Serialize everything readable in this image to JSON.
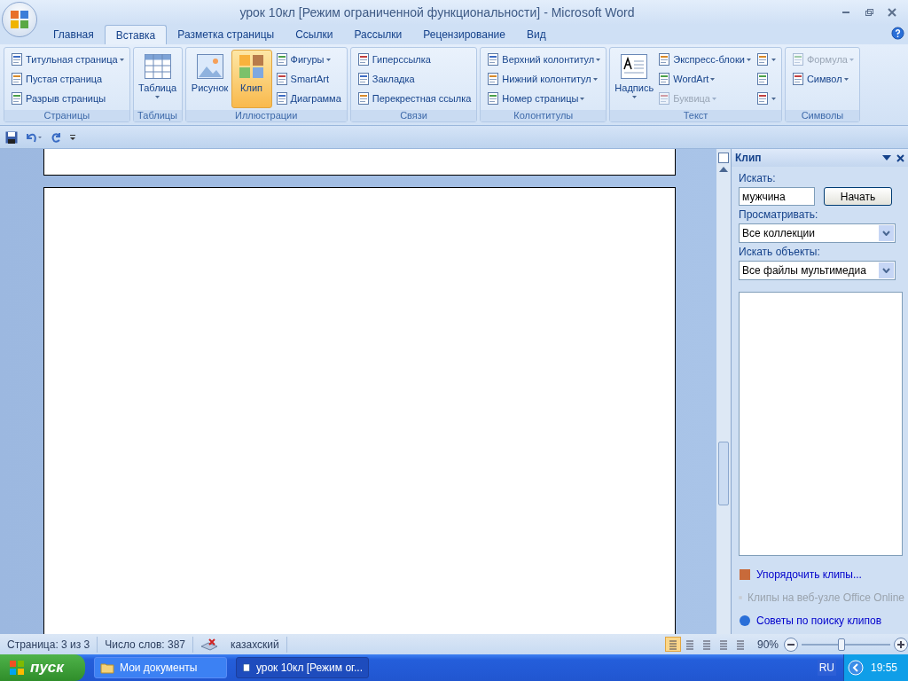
{
  "window": {
    "title": "урок 10кл [Режим ограниченной функциональности] - Microsoft Word"
  },
  "tabs": [
    {
      "label": "Главная",
      "selected": false
    },
    {
      "label": "Вставка",
      "selected": true
    },
    {
      "label": "Разметка страницы",
      "selected": false
    },
    {
      "label": "Ссылки",
      "selected": false
    },
    {
      "label": "Рассылки",
      "selected": false
    },
    {
      "label": "Рецензирование",
      "selected": false
    },
    {
      "label": "Вид",
      "selected": false
    }
  ],
  "ribbon": {
    "groups": [
      {
        "label": "Страницы",
        "columns": [
          [
            {
              "kind": "small",
              "label": "Титульная страница",
              "dropdown": true,
              "disabled": false
            },
            {
              "kind": "small",
              "label": "Пустая страница",
              "dropdown": false,
              "disabled": false
            },
            {
              "kind": "small",
              "label": "Разрыв страницы",
              "dropdown": false,
              "disabled": false
            }
          ]
        ]
      },
      {
        "label": "Таблицы",
        "columns": [
          [
            {
              "kind": "large",
              "label": "Таблица",
              "dropdown": true,
              "disabled": false,
              "selected": false
            }
          ]
        ]
      },
      {
        "label": "Иллюстрации",
        "columns": [
          [
            {
              "kind": "large",
              "label": "Рисунок",
              "dropdown": false,
              "disabled": false,
              "selected": false
            }
          ],
          [
            {
              "kind": "large",
              "label": "Клип",
              "dropdown": false,
              "disabled": false,
              "selected": true
            }
          ],
          [
            {
              "kind": "small",
              "label": "Фигуры",
              "dropdown": true,
              "disabled": false
            },
            {
              "kind": "small",
              "label": "SmartArt",
              "dropdown": false,
              "disabled": false
            },
            {
              "kind": "small",
              "label": "Диаграмма",
              "dropdown": false,
              "disabled": false
            }
          ]
        ]
      },
      {
        "label": "Связи",
        "columns": [
          [
            {
              "kind": "small",
              "label": "Гиперссылка",
              "dropdown": false,
              "disabled": false
            },
            {
              "kind": "small",
              "label": "Закладка",
              "dropdown": false,
              "disabled": false
            },
            {
              "kind": "small",
              "label": "Перекрестная ссылка",
              "dropdown": false,
              "disabled": false
            }
          ]
        ]
      },
      {
        "label": "Колонтитулы",
        "columns": [
          [
            {
              "kind": "small",
              "label": "Верхний колонтитул",
              "dropdown": true,
              "disabled": false
            },
            {
              "kind": "small",
              "label": "Нижний колонтитул",
              "dropdown": true,
              "disabled": false
            },
            {
              "kind": "small",
              "label": "Номер страницы",
              "dropdown": true,
              "disabled": false
            }
          ]
        ]
      },
      {
        "label": "Текст",
        "columns": [
          [
            {
              "kind": "large",
              "label": "Надпись",
              "dropdown": true,
              "disabled": false,
              "selected": false
            }
          ],
          [
            {
              "kind": "small",
              "label": "Экспресс-блоки",
              "dropdown": true,
              "disabled": false
            },
            {
              "kind": "small",
              "label": "WordArt",
              "dropdown": true,
              "disabled": false
            },
            {
              "kind": "small",
              "label": "Буквица",
              "dropdown": true,
              "disabled": true
            }
          ],
          [
            {
              "kind": "icon",
              "dropdown": true,
              "disabled": false
            },
            {
              "kind": "icon",
              "dropdown": false,
              "disabled": false
            },
            {
              "kind": "icon",
              "dropdown": true,
              "disabled": false
            }
          ]
        ]
      },
      {
        "label": "Символы",
        "columns": [
          [
            {
              "kind": "small",
              "label": "Формула",
              "dropdown": true,
              "disabled": true
            },
            {
              "kind": "small",
              "label": "Символ",
              "dropdown": true,
              "disabled": false
            }
          ]
        ]
      }
    ]
  },
  "task_pane": {
    "title": "Клип",
    "search_label": "Искать:",
    "search_value": "мужчина",
    "search_button": "Начать",
    "browse_label": "Просматривать:",
    "browse_value": "Все коллекции",
    "objects_label": "Искать объекты:",
    "objects_value": "Все файлы мультимедиа",
    "links": [
      {
        "label": "Упорядочить клипы...",
        "disabled": false
      },
      {
        "label": "Клипы на веб-узле Office Online",
        "disabled": true
      },
      {
        "label": "Советы по поиску клипов",
        "disabled": false
      }
    ]
  },
  "status_bar": {
    "page": "Страница: 3 из 3",
    "words": "Число слов: 387",
    "language": "казахский",
    "views": [
      {
        "selected": true
      },
      {
        "selected": false
      },
      {
        "selected": false
      },
      {
        "selected": false
      },
      {
        "selected": false
      }
    ],
    "zoom": "90%",
    "zoom_slider": {
      "level": 0.45
    }
  },
  "taskbar": {
    "start": "пуск",
    "tasks": [
      {
        "label": "Мои документы",
        "selected": false
      },
      {
        "label": "урок 10кл [Режим ог...",
        "selected": true
      }
    ],
    "language": "RU",
    "time": "19:55"
  }
}
